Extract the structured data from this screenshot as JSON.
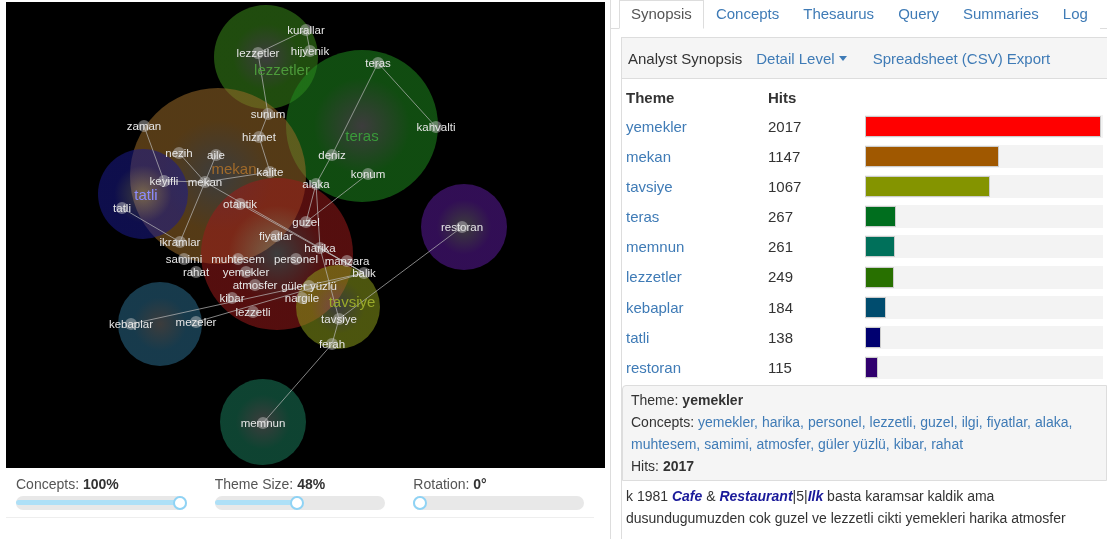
{
  "map": {
    "theme_labels": [
      "lezzetler",
      "teras",
      "mekan",
      "tatli",
      "tavsiye"
    ],
    "concepts": [
      "kurallar",
      "hijyenik",
      "lezzetler",
      "teras",
      "sunum",
      "zaman",
      "kahvalti",
      "hizmet",
      "nezih",
      "aile",
      "deniz",
      "kalite",
      "keyifli",
      "mekan",
      "konum",
      "alaka",
      "tatli",
      "otantik",
      "guzel",
      "fiyatlar",
      "ikramlar",
      "restoran",
      "harika",
      "samimi",
      "muhtesem",
      "personel",
      "manzara",
      "rahat",
      "yemekler",
      "balik",
      "atmosfer",
      "güler yüzlü",
      "kibar",
      "nargile",
      "lezzetli",
      "tavsiye",
      "kebaplar",
      "mezeler",
      "ferah",
      "memnun"
    ]
  },
  "sliders": [
    {
      "label": "Concepts: **100%**",
      "level": 1
    },
    {
      "label": "Theme Size: **48%**",
      "level": 0.48
    },
    {
      "label": "Rotation: **0°**",
      "level": 0
    }
  ],
  "tabs": [
    {
      "label": "Synopsis",
      "selected": true
    },
    {
      "label": "Concepts",
      "selected": false
    },
    {
      "label": "Thesaurus",
      "selected": false
    },
    {
      "label": "Query",
      "selected": false
    },
    {
      "label": "Summaries",
      "selected": false
    },
    {
      "label": "Log",
      "selected": false
    }
  ],
  "toolbar": {
    "title": "Analyst Synopsis",
    "dropdown": "Detail Level",
    "export_link": "Spreadsheet (CSV) Export"
  },
  "synopsis": {
    "columns": [
      "Theme",
      "Hits"
    ],
    "rows": [
      {
        "theme": "yemekler",
        "hits": "2017",
        "level": 1,
        "color": "#ff0000"
      },
      {
        "theme": "mekan",
        "hits": "1147",
        "level": 0.569,
        "color": "#a05800"
      },
      {
        "theme": "tavsiye",
        "hits": "1067",
        "level": 0.529,
        "color": "#849400"
      },
      {
        "theme": "teras",
        "hits": "267",
        "level": 0.132,
        "color": "#006e1e"
      },
      {
        "theme": "memnun",
        "hits": "261",
        "level": 0.129,
        "color": "#00705a"
      },
      {
        "theme": "lezzetler",
        "hits": "249",
        "level": 0.123,
        "color": "#287000"
      },
      {
        "theme": "kebaplar",
        "hits": "184",
        "level": 0.091,
        "color": "#004c6e"
      },
      {
        "theme": "tatli",
        "hits": "138",
        "level": 0.068,
        "color": "#000070"
      },
      {
        "theme": "restoran",
        "hits": "115",
        "level": 0.057,
        "color": "#30006e"
      }
    ]
  },
  "detail": {
    "theme_line": "Theme: **yemekler**",
    "concepts_label": "Concepts:",
    "concepts": [
      "yemekler,",
      "harika,",
      "personel,",
      "lezzetli,",
      "guzel,",
      "ilgi,",
      "fiyatlar,",
      "alaka,",
      "muhtesem,",
      "samimi,",
      "atmosfer,",
      "güler yüzlü,",
      "kibar,",
      "rahat"
    ],
    "hits_line": "Hits: **2017**"
  },
  "excerpt": "k 1981 **Cafe** & **Restaurant**|5|**Ilk** basta karamsar kaldik ama dusundugumuzden cok guzel ve lezzetli cikti yemekleri harika atmosfer"
}
